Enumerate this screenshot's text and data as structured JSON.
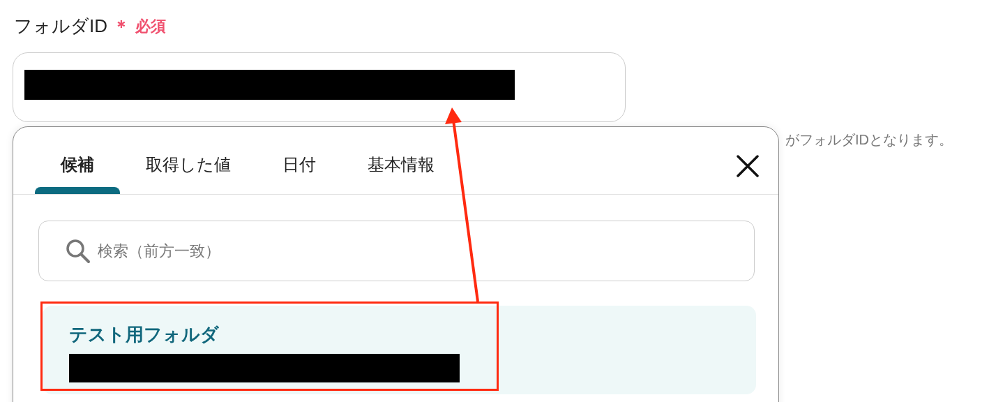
{
  "field": {
    "label": "フォルダID",
    "required_mark": "＊",
    "required_text": "必須",
    "hint": "がフォルダIDとなります。"
  },
  "popover": {
    "tabs": [
      {
        "label": "候補",
        "selected": true
      },
      {
        "label": "取得した値",
        "selected": false
      },
      {
        "label": "日付",
        "selected": false
      },
      {
        "label": "基本情報",
        "selected": false
      }
    ],
    "search": {
      "placeholder": "検索（前方一致）"
    },
    "options": [
      {
        "title": "テスト用フォルダ",
        "highlighted": true
      }
    ]
  }
}
